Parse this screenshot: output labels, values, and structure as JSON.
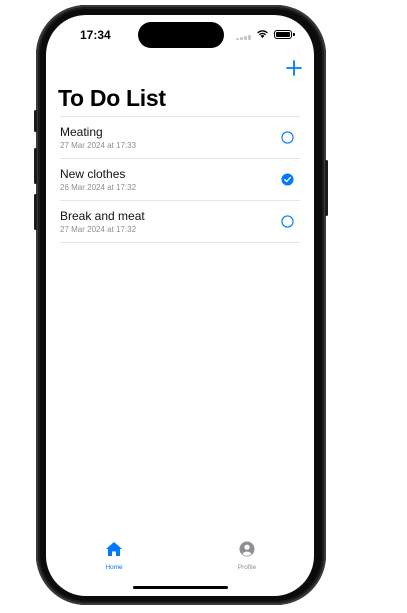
{
  "status_bar": {
    "time": "17:34"
  },
  "header": {
    "title": "To Do List",
    "add_icon": "plus-icon"
  },
  "tasks": [
    {
      "name": "Meating",
      "date": "27 Mar 2024 at 17:33",
      "completed": false
    },
    {
      "name": "New clothes",
      "date": "26 Mar 2024 at 17:32",
      "completed": true
    },
    {
      "name": "Break and meat",
      "date": "27 Mar 2024 at 17:32",
      "completed": false
    }
  ],
  "tab_bar": {
    "tabs": [
      {
        "label": "Home",
        "icon": "house-icon",
        "selected": true
      },
      {
        "label": "Profile",
        "icon": "person-circle-icon",
        "selected": false
      }
    ]
  },
  "colors": {
    "accent": "#007aff",
    "inactive": "#8e8e93"
  }
}
